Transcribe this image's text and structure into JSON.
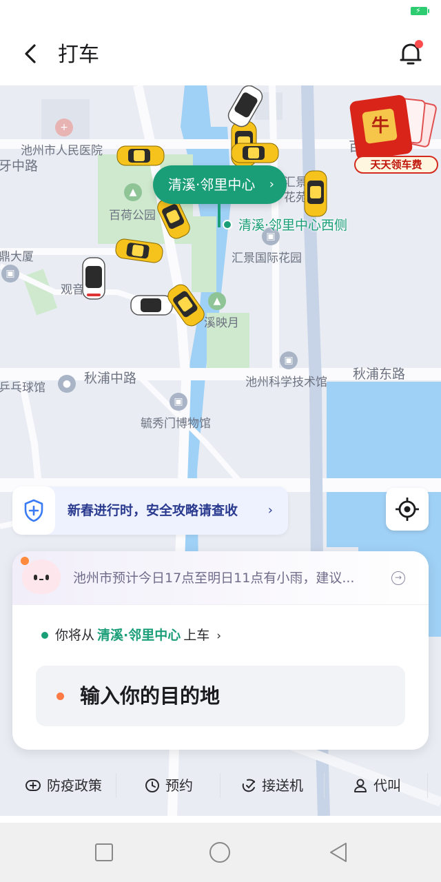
{
  "header": {
    "title": "打车"
  },
  "map": {
    "labels": {
      "hospital": "池州市人民医院",
      "road_ya": "牙中路",
      "park": "百荷公园",
      "building": "鼎大厦",
      "guanyin": "观音",
      "huijing_top": "汇景",
      "huijing_top2": "花苑",
      "huijing": "汇景国际花园",
      "qingxi": "溪映月",
      "qiupu_mid": "秋浦中路",
      "qiupu_east": "秋浦东路",
      "pingpong": "乒乓球馆",
      "science_museum": "池州科学技术馆",
      "museum": "毓秀门博物馆",
      "bai_right": "百"
    },
    "pickup_bubble": "清溪·邻里中心",
    "pickup_side_label": "清溪·邻里中心西侧",
    "promo_text": "天天领车费",
    "promo_glyph": "牛"
  },
  "safety_banner": {
    "text": "新春进行时，安全攻略请查收"
  },
  "card": {
    "weather_text": "池州市预计今日17点至明日11点有小雨，建议...",
    "pickup_prefix": "你将从",
    "pickup_place": "清溪·邻里中心",
    "pickup_suffix": "上车",
    "destination_placeholder": "输入你的目的地"
  },
  "quick_actions": [
    {
      "label": "防疫政策",
      "icon": "shield-plus-icon"
    },
    {
      "label": "预约",
      "icon": "clock-icon"
    },
    {
      "label": "接送机",
      "icon": "plane-icon"
    },
    {
      "label": "代叫",
      "icon": "person-icon"
    }
  ],
  "colors": {
    "brand_green": "#1a9e78",
    "destination_dot": "#ff7a45",
    "banner_text": "#2a3a8f"
  }
}
